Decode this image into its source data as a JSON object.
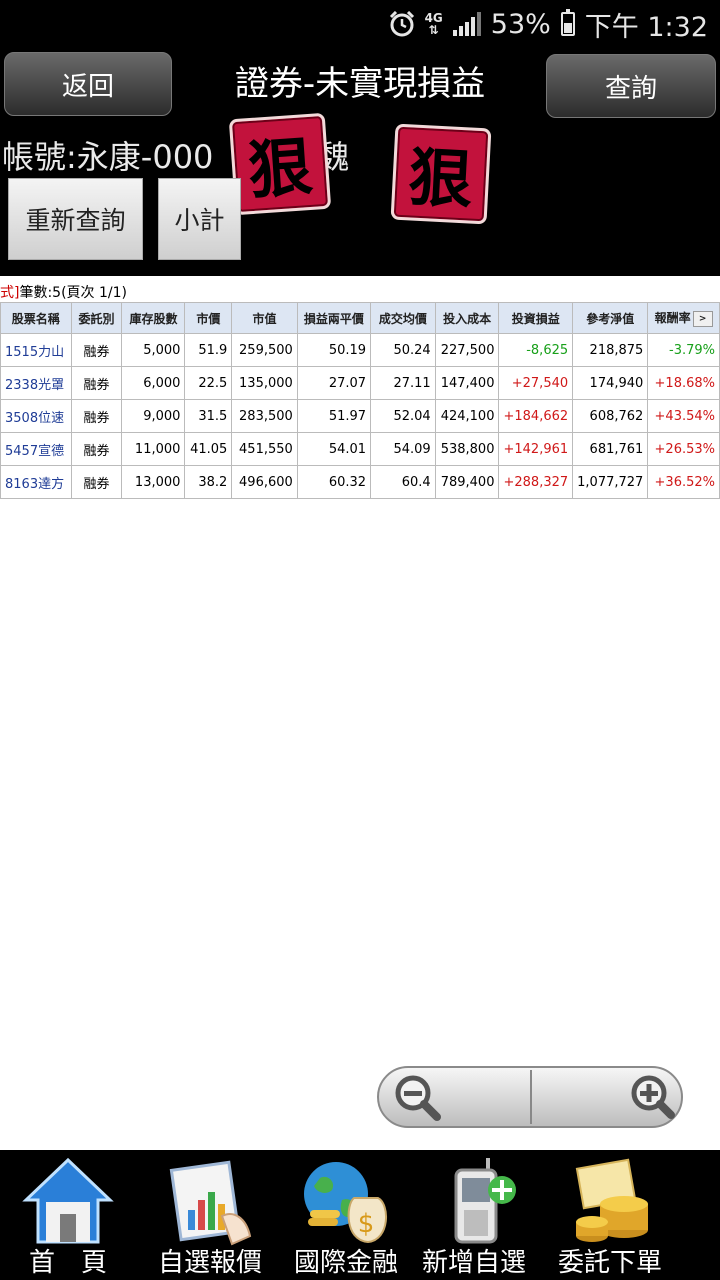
{
  "status": {
    "battery": "53%",
    "time": "下午 1:32",
    "network": "4G"
  },
  "header": {
    "back_label": "返回",
    "title": "證券-未實現損益",
    "query_label": "查詢",
    "account_text": "帳號:永康-000",
    "account_name_fragment": "魏",
    "stamp_text": "狠",
    "requery_label": "重新查詢",
    "subtotal_label": "小計"
  },
  "summary": {
    "prefix": "式]",
    "text": "筆數:5(頁次 1/1)"
  },
  "table": {
    "headers": [
      "股票名稱",
      "委託別",
      "庫存股數",
      "市價",
      "市值",
      "損益兩平價",
      "成交均價",
      "投入成本",
      "投資損益",
      "參考淨值",
      "報酬率"
    ],
    "rows": [
      [
        "1515力山",
        "融券",
        "5,000",
        "51.9",
        "259,500",
        "50.19",
        "50.24",
        "227,500",
        "-8,625",
        "218,875",
        "-3.79%"
      ],
      [
        "2338光罩",
        "融券",
        "6,000",
        "22.5",
        "135,000",
        "27.07",
        "27.11",
        "147,400",
        "+27,540",
        "174,940",
        "+18.68%"
      ],
      [
        "3508位速",
        "融券",
        "9,000",
        "31.5",
        "283,500",
        "51.97",
        "52.04",
        "424,100",
        "+184,662",
        "608,762",
        "+43.54%"
      ],
      [
        "5457宣德",
        "融券",
        "11,000",
        "41.05",
        "451,550",
        "54.01",
        "54.09",
        "538,800",
        "+142,961",
        "681,761",
        "+26.53%"
      ],
      [
        "8163達方",
        "融券",
        "13,000",
        "38.2",
        "496,600",
        "60.32",
        "60.4",
        "789,400",
        "+288,327",
        "1,077,727",
        "+36.52%"
      ]
    ]
  },
  "nav": {
    "items": [
      {
        "label": "首　頁",
        "icon": "home-icon"
      },
      {
        "label": "自選報價",
        "icon": "chart-quote-icon"
      },
      {
        "label": "國際金融",
        "icon": "globe-money-icon"
      },
      {
        "label": "新增自選",
        "icon": "phone-add-icon"
      },
      {
        "label": "委託下單",
        "icon": "coins-order-icon"
      }
    ]
  },
  "colors": {
    "header_bg": "#000000",
    "table_header_bg": "#dde6f3",
    "gain": "#d01818",
    "loss": "#18a01a",
    "stock_name": "#1f3c96"
  }
}
